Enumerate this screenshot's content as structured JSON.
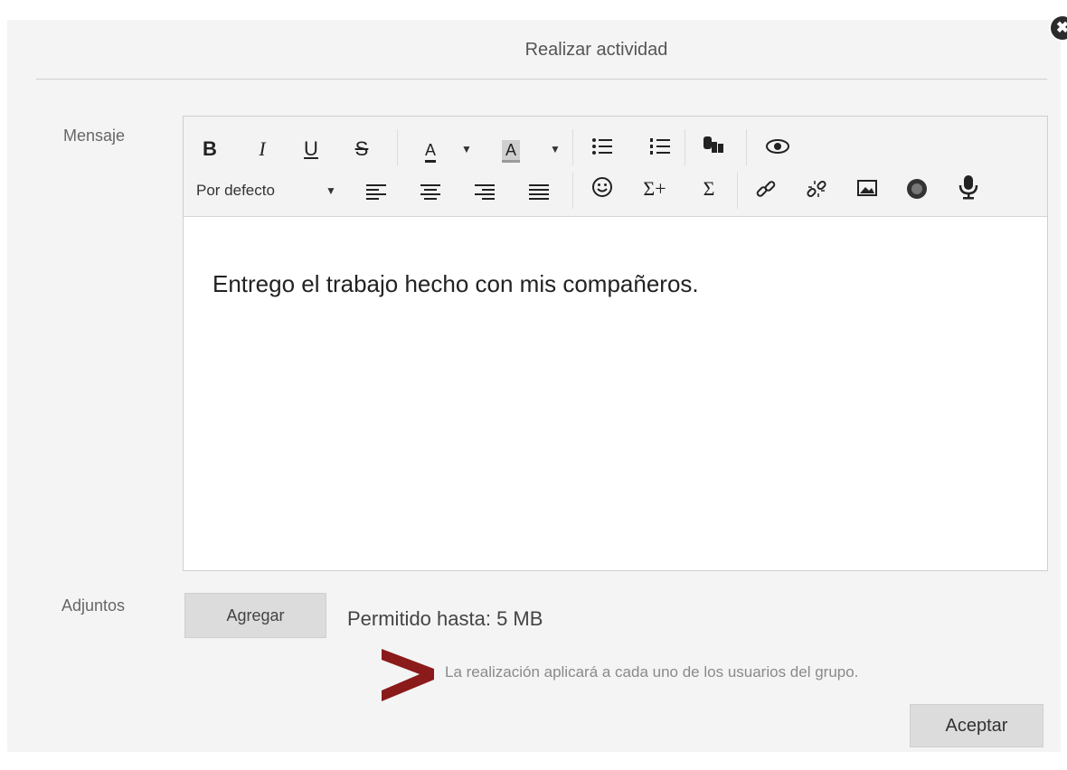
{
  "dialog": {
    "title": "Realizar actividad",
    "close_glyph": "✖"
  },
  "form": {
    "message_label": "Mensaje",
    "attachments_label": "Adjuntos"
  },
  "toolbar": {
    "bold": "B",
    "italic": "I",
    "underline": "U",
    "strike": "S",
    "font_color": "A",
    "highlight": "A",
    "font_select": "Por defecto",
    "sigma_plus": "Σ+",
    "sigma": "Σ",
    "icons": [
      "bold-icon",
      "italic-icon",
      "underline-icon",
      "strikethrough-icon",
      "font-color-icon",
      "highlight-color-icon",
      "bulleted-list-icon",
      "numbered-list-icon",
      "paste-format-icon",
      "preview-icon",
      "align-left-icon",
      "align-center-icon",
      "align-right-icon",
      "justify-icon",
      "emoji-icon",
      "formula-plus-icon",
      "formula-icon",
      "link-icon",
      "unlink-icon",
      "image-icon",
      "embed-3d-icon",
      "microphone-icon"
    ]
  },
  "editor": {
    "content": "Entrego el trabajo hecho con mis compañeros."
  },
  "attachments": {
    "add_button": "Agregar",
    "allowed": "Permitido hasta: 5 MB"
  },
  "notice": {
    "text": "La realización aplicará a cada uno de los usuarios del grupo.",
    "arrow_color": "#8b1a1a"
  },
  "actions": {
    "accept": "Aceptar"
  }
}
